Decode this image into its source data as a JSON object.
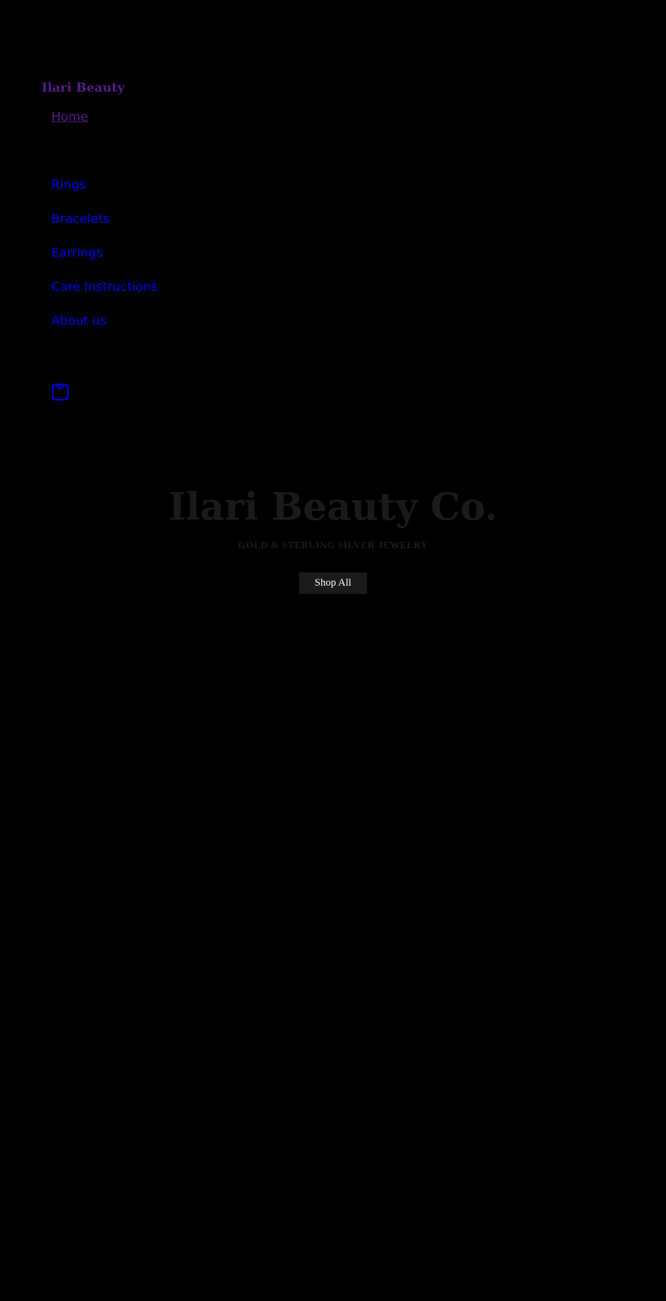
{
  "header": {
    "brand": "Ilari Beauty",
    "nav": {
      "home": "Home",
      "rings": "Rings",
      "bracelets": "Bracelets",
      "earrings": "Earrings",
      "care": "Care Instructions",
      "about": "About us"
    },
    "cart_icon": "shopping-bag-icon"
  },
  "hero": {
    "title": "Ilari Beauty Co.",
    "subtitle": "GOLD & STERLING SILVER JEWELRY",
    "button": "Shop All"
  },
  "colors": {
    "background": "#000000",
    "link": "#0000ee",
    "visited_link": "#551a8b",
    "hero_text": "#1a1a1a",
    "button_bg": "#1a1a1a",
    "button_text": "#ffffff"
  }
}
